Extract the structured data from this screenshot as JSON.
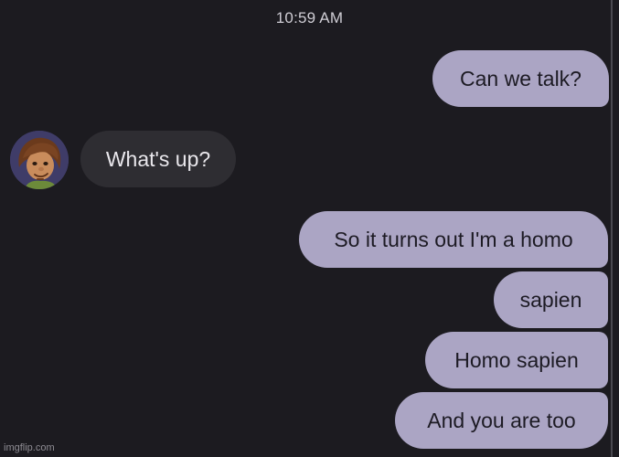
{
  "header": {
    "time": "10:59 AM"
  },
  "conversation": {
    "messages": [
      {
        "direction": "sent",
        "text": "Can we talk?"
      },
      {
        "direction": "received",
        "text": "What's up?"
      },
      {
        "direction": "sent",
        "text": "So it turns out I'm a homo"
      },
      {
        "direction": "sent",
        "text": "sapien"
      },
      {
        "direction": "sent",
        "text": "Homo sapien"
      },
      {
        "direction": "sent",
        "text": "And you are too"
      }
    ]
  },
  "contact": {
    "avatar_icon": "cartoon-character-avatar"
  },
  "colors": {
    "background": "#1c1b20",
    "sent_bubble": "#aba5c4",
    "received_bubble": "#2e2d32",
    "avatar_background": "#3f3c68"
  },
  "watermark": {
    "text": "imgflip.com"
  }
}
